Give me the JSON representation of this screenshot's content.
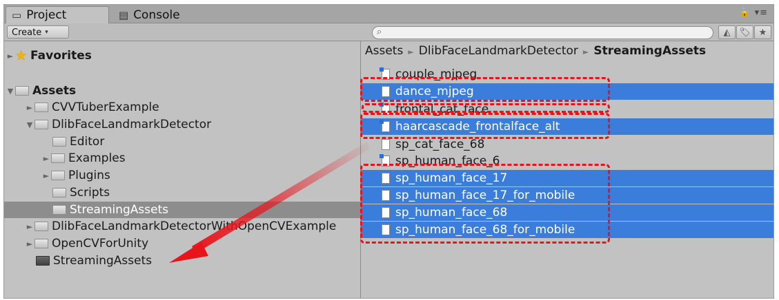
{
  "tabs": [
    {
      "label": "Project",
      "icon": "folder-icon"
    },
    {
      "label": "Console",
      "icon": "console-icon"
    }
  ],
  "toolbar": {
    "create_label": "Create",
    "create_arrow": "▾",
    "search_icon": "⌕",
    "lock_icon": "🔒",
    "menu_icon": "▾≡"
  },
  "tree": {
    "favorites": "Favorites",
    "assets": "Assets",
    "items": [
      "CVVTuberExample",
      "DlibFaceLandmarkDetector",
      "Editor",
      "Examples",
      "Plugins",
      "Scripts",
      "StreamingAssets",
      "DlibFaceLandmarkDetectorWithOpenCVExample",
      "OpenCVForUnity",
      "StreamingAssets"
    ]
  },
  "breadcrumb": {
    "part1": "Assets",
    "part2": "DlibFaceLandmarkDetector",
    "part3": "StreamingAssets",
    "sep": "►"
  },
  "files": [
    "couple_mjpeg",
    "dance_mjpeg",
    "frontal_cat_face",
    "haarcascade_frontalface_alt",
    "sp_cat_face_68",
    "sp_human_face_6",
    "sp_human_face_17",
    "sp_human_face_17_for_mobile",
    "sp_human_face_68",
    "sp_human_face_68_for_mobile"
  ],
  "colors": {
    "selection": "#3b7ddb",
    "annotation": "#e8141b"
  }
}
